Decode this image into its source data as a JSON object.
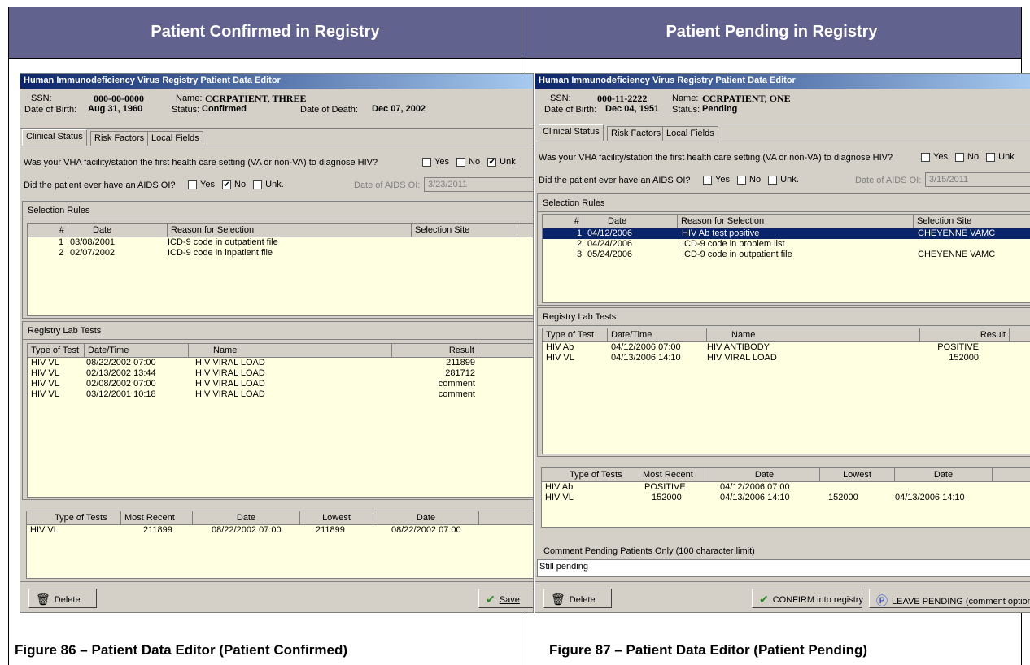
{
  "headers": {
    "left": "Patient Confirmed in Registry",
    "right": "Patient Pending in Registry"
  },
  "captions": {
    "left": "Figure 86 – Patient Data Editor (Patient Confirmed)",
    "right": "Figure 87 – Patient Data Editor (Patient Pending)"
  },
  "confirmed": {
    "title": "Human Immunodeficiency Virus Registry Patient Data Editor",
    "ssn_label": "SSN:",
    "ssn": "000-00-0000",
    "name_label": "Name:",
    "name": "CCRPATIENT, THREE",
    "dob_label": "Date of Birth:",
    "dob": "Aug 31, 1960",
    "status_label": "Status:",
    "status": "Confirmed",
    "dod_label": "Date of Death:",
    "dod": "Dec 07, 2002",
    "tabs": [
      "Clinical Status",
      "Risk Factors",
      "Local Fields"
    ],
    "q1": "Was your VHA facility/station the first health care setting (VA or non-VA) to diagnose HIV?",
    "q1_opts": [
      "Yes",
      "No",
      "Unk"
    ],
    "q2": "Did the patient ever have an AIDS OI?",
    "q2_opts": [
      "Yes",
      "No",
      "Unk."
    ],
    "aids_date_label": "Date of AIDS OI:",
    "aids_date": "3/23/2011",
    "selection_title": "Selection Rules",
    "sel_cols": [
      "#",
      "Date",
      "Reason for Selection",
      "Selection Site"
    ],
    "sel_rows": [
      {
        "n": "1",
        "date": "03/08/2001",
        "reason": "ICD-9 code in outpatient file",
        "site": ""
      },
      {
        "n": "2",
        "date": "02/07/2002",
        "reason": "ICD-9 code in inpatient file",
        "site": ""
      }
    ],
    "lab_title": "Registry Lab Tests",
    "lab_cols": [
      "Type of Test",
      "Date/Time",
      "Name",
      "Result"
    ],
    "lab_rows": [
      {
        "type": "HIV VL",
        "dt": "08/22/2002 07:00",
        "name": "HIV VIRAL LOAD",
        "result": "211899"
      },
      {
        "type": "HIV VL",
        "dt": "02/13/2002 13:44",
        "name": "HIV VIRAL LOAD",
        "result": "281712"
      },
      {
        "type": "HIV VL",
        "dt": "02/08/2002 07:00",
        "name": "HIV VIRAL LOAD",
        "result": "comment"
      },
      {
        "type": "HIV VL",
        "dt": "03/12/2001 10:18",
        "name": "HIV VIRAL LOAD",
        "result": "comment"
      }
    ],
    "sum_cols": [
      "Type of Tests",
      "Most Recent",
      "Date",
      "Lowest",
      "Date"
    ],
    "sum_rows": [
      {
        "type": "HIV VL",
        "recent": "211899",
        "date": "08/22/2002 07:00",
        "lowest": "211899",
        "ldate": "08/22/2002 07:00"
      }
    ],
    "delete": "Delete",
    "save": "Save"
  },
  "pending": {
    "title": "Human Immunodeficiency Virus Registry Patient Data Editor",
    "ssn_label": "SSN:",
    "ssn": "000-11-2222",
    "name_label": "Name:",
    "name": "CCRPATIENT, ONE",
    "dob_label": "Date of Birth:",
    "dob": "Dec 04, 1951",
    "status_label": "Status:",
    "status": "Pending",
    "tabs": [
      "Clinical Status",
      "Risk Factors",
      "Local Fields"
    ],
    "q1": "Was your VHA facility/station the first health care setting (VA or non-VA) to diagnose HIV?",
    "q1_opts": [
      "Yes",
      "No",
      "Unk"
    ],
    "q2": "Did the patient ever have an AIDS OI?",
    "q2_opts": [
      "Yes",
      "No",
      "Unk."
    ],
    "aids_date_label": "Date of AIDS OI:",
    "aids_date": "3/15/2011",
    "selection_title": "Selection Rules",
    "sel_cols": [
      "#",
      "Date",
      "Reason for Selection",
      "Selection Site"
    ],
    "sel_rows": [
      {
        "n": "1",
        "date": "04/12/2006",
        "reason": "HIV Ab test positive",
        "site": "CHEYENNE VAMC"
      },
      {
        "n": "2",
        "date": "04/24/2006",
        "reason": "ICD-9 code in problem list",
        "site": ""
      },
      {
        "n": "3",
        "date": "05/24/2006",
        "reason": "ICD-9 code in outpatient file",
        "site": "CHEYENNE VAMC"
      }
    ],
    "lab_title": "Registry Lab Tests",
    "lab_cols": [
      "Type of Test",
      "Date/Time",
      "Name",
      "Result"
    ],
    "lab_rows": [
      {
        "type": "HIV Ab",
        "dt": "04/12/2006 07:00",
        "name": "HIV ANTIBODY",
        "result": "POSITIVE"
      },
      {
        "type": "HIV VL",
        "dt": "04/13/2006 14:10",
        "name": "HIV VIRAL LOAD",
        "result": "152000"
      }
    ],
    "sum_cols": [
      "Type of Tests",
      "Most Recent",
      "Date",
      "Lowest",
      "Date"
    ],
    "sum_rows": [
      {
        "type": "HIV Ab",
        "recent": "POSITIVE",
        "date": "04/12/2006 07:00",
        "lowest": "",
        "ldate": ""
      },
      {
        "type": "HIV VL",
        "recent": "152000",
        "date": "04/13/2006 14:10",
        "lowest": "152000",
        "ldate": "04/13/2006 14:10"
      }
    ],
    "comment_title": "Comment Pending Patients Only (100 character limit)",
    "comment": "Still pending",
    "delete": "Delete",
    "confirm": "CONFIRM into registry",
    "leave": "LEAVE PENDING (comment optiona"
  }
}
